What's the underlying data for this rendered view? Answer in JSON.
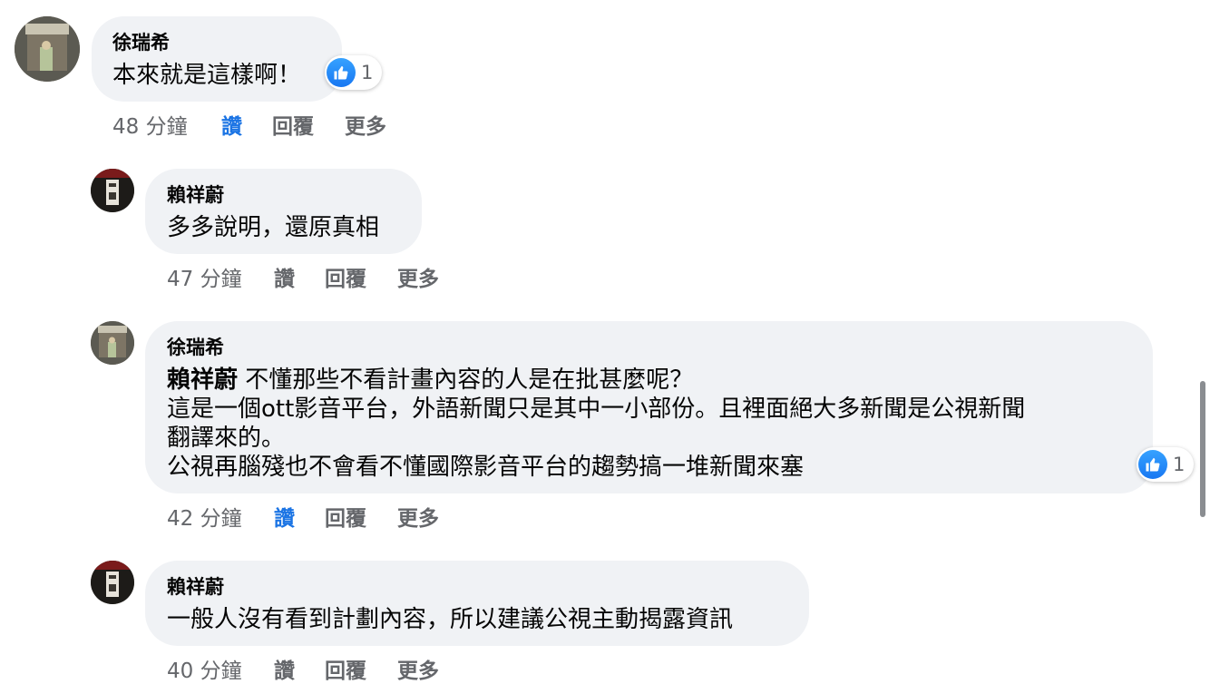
{
  "comments": [
    {
      "author": "徐瑞希",
      "lines": [
        "本來就是這樣啊！"
      ],
      "reaction_count": "1",
      "time": "48 分鐘",
      "like": "讚",
      "reply": "回覆",
      "more": "更多",
      "liked": true
    },
    {
      "author": "賴祥蔚",
      "lines": [
        "多多說明，還原真相"
      ],
      "time": "47 分鐘",
      "like": "讚",
      "reply": "回覆",
      "more": "更多",
      "liked": false
    },
    {
      "author": "徐瑞希",
      "mention": "賴祥蔚",
      "lines": [
        " 不懂那些不看計畫內容的人是在批甚麼呢？",
        "這是一個ott影音平台，外語新聞只是其中一小部份。且裡面絕大多新聞是公視新聞",
        "翻譯來的。",
        "公視再腦殘也不會看不懂國際影音平台的趨勢搞一堆新聞來塞"
      ],
      "reaction_count": "1",
      "time": "42 分鐘",
      "like": "讚",
      "reply": "回覆",
      "more": "更多",
      "liked": true
    },
    {
      "author": "賴祥蔚",
      "lines": [
        "一般人沒有看到計劃內容，所以建議公視主動揭露資訊"
      ],
      "time": "40 分鐘",
      "like": "讚",
      "reply": "回覆",
      "more": "更多",
      "liked": false
    }
  ],
  "colors": {
    "bubble": "#f0f2f5",
    "meta_text": "#65676b",
    "like_active": "#1b74e4"
  },
  "icons": {
    "reaction": "like-thumb-icon"
  }
}
